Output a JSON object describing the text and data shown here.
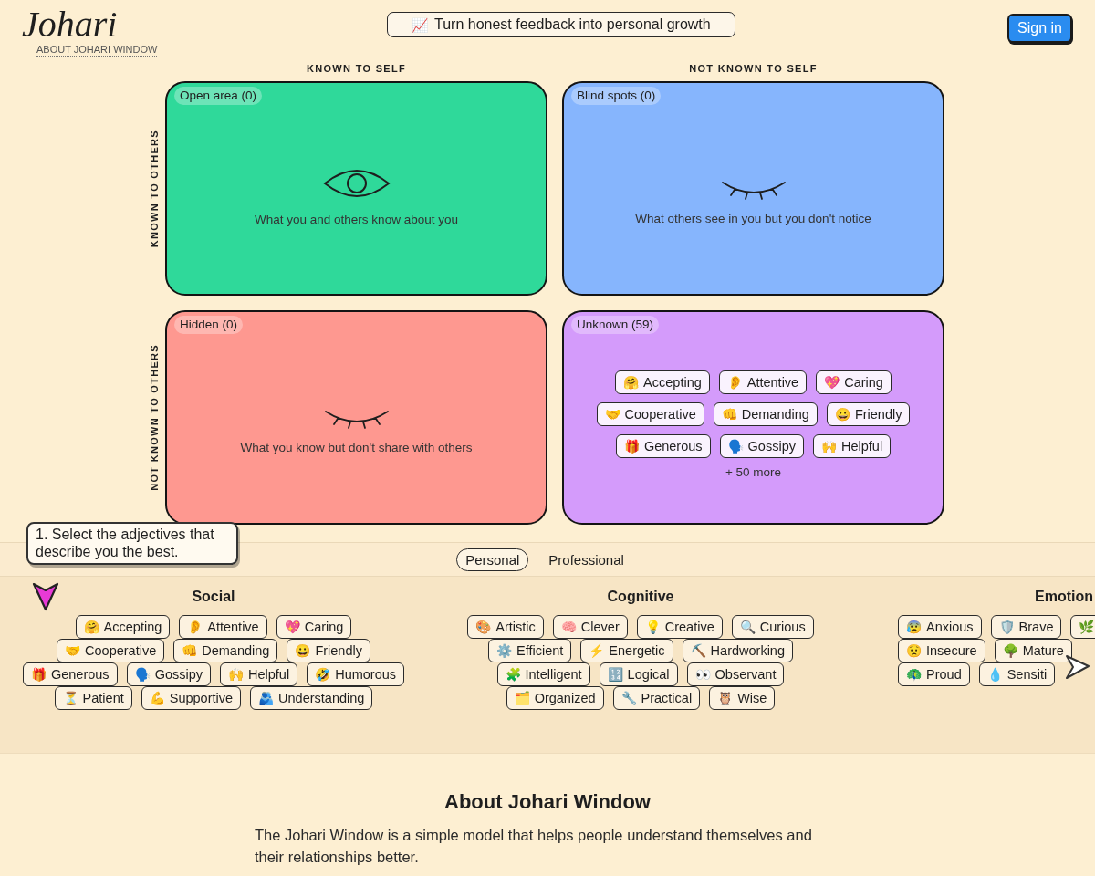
{
  "header": {
    "logo": "Johari",
    "about_link": "ABOUT JOHARI WINDOW",
    "tagline": {
      "emoji": "📈",
      "text": "Turn honest feedback into personal growth"
    },
    "sign_in": "Sign in"
  },
  "johari_window": {
    "column_headers": [
      "KNOWN TO SELF",
      "NOT KNOWN TO SELF"
    ],
    "row_headers": [
      "KNOWN TO OTHERS",
      "NOT KNOWN TO OTHERS"
    ],
    "quadrants": [
      {
        "kind": "open",
        "label": "Open area (0)",
        "color": "#2fd99a",
        "description": "What you and others know about you"
      },
      {
        "kind": "blind",
        "label": "Blind spots (0)",
        "color": "#86b5fd",
        "description": "What others see in you but you don't notice"
      },
      {
        "kind": "hidden",
        "label": "Hidden (0)",
        "color": "#fe9890",
        "description": "What you know but don't share with others"
      },
      {
        "kind": "unknown",
        "label": "Unknown (59)",
        "color": "#d49bfb",
        "chip_rows": [
          [
            {
              "emoji": "🤗",
              "label": "Accepting"
            },
            {
              "emoji": "👂",
              "label": "Attentive"
            },
            {
              "emoji": "💖",
              "label": "Caring"
            }
          ],
          [
            {
              "emoji": "🤝",
              "label": "Cooperative"
            },
            {
              "emoji": "👊",
              "label": "Demanding"
            },
            {
              "emoji": "😀",
              "label": "Friendly"
            }
          ],
          [
            {
              "emoji": "🎁",
              "label": "Generous"
            },
            {
              "emoji": "🗣️",
              "label": "Gossipy"
            },
            {
              "emoji": "🙌",
              "label": "Helpful"
            }
          ]
        ],
        "more": "+ 50 more"
      }
    ]
  },
  "tooltip": "1. Select the adjectives that describe you the best.",
  "tabs": [
    {
      "label": "Personal",
      "selected": true
    },
    {
      "label": "Professional",
      "selected": false
    }
  ],
  "categories": [
    {
      "title": "Social",
      "chip_rows": [
        [
          {
            "emoji": "🤗",
            "label": "Accepting"
          },
          {
            "emoji": "👂",
            "label": "Attentive"
          },
          {
            "emoji": "💖",
            "label": "Caring"
          }
        ],
        [
          {
            "emoji": "🤝",
            "label": "Cooperative"
          },
          {
            "emoji": "👊",
            "label": "Demanding"
          },
          {
            "emoji": "😀",
            "label": "Friendly"
          }
        ],
        [
          {
            "emoji": "🎁",
            "label": "Generous"
          },
          {
            "emoji": "🗣️",
            "label": "Gossipy"
          },
          {
            "emoji": "🙌",
            "label": "Helpful"
          },
          {
            "emoji": "🤣",
            "label": "Humorous"
          }
        ],
        [
          {
            "emoji": "⏳",
            "label": "Patient"
          },
          {
            "emoji": "💪",
            "label": "Supportive"
          },
          {
            "emoji": "🫂",
            "label": "Understanding"
          }
        ]
      ]
    },
    {
      "title": "Cognitive",
      "chip_rows": [
        [
          {
            "emoji": "🎨",
            "label": "Artistic"
          },
          {
            "emoji": "🧠",
            "label": "Clever"
          },
          {
            "emoji": "💡",
            "label": "Creative"
          },
          {
            "emoji": "🔍",
            "label": "Curious"
          }
        ],
        [
          {
            "emoji": "⚙️",
            "label": "Efficient"
          },
          {
            "emoji": "⚡",
            "label": "Energetic"
          },
          {
            "emoji": "⛏️",
            "label": "Hardworking"
          }
        ],
        [
          {
            "emoji": "🧩",
            "label": "Intelligent"
          },
          {
            "emoji": "🔢",
            "label": "Logical"
          },
          {
            "emoji": "👀",
            "label": "Observant"
          }
        ],
        [
          {
            "emoji": "🗂️",
            "label": "Organized"
          },
          {
            "emoji": "🔧",
            "label": "Practical"
          },
          {
            "emoji": "🦉",
            "label": "Wise"
          }
        ]
      ]
    },
    {
      "title": "Emotion",
      "chip_rows": [
        [
          {
            "emoji": "😰",
            "label": "Anxious"
          },
          {
            "emoji": "🛡️",
            "label": "Brave"
          },
          {
            "emoji": "🌿"
          }
        ],
        [
          {
            "emoji": "😟",
            "label": "Insecure"
          },
          {
            "emoji": "🌳",
            "label": "Mature"
          }
        ],
        [
          {
            "emoji": "🦚",
            "label": "Proud"
          },
          {
            "emoji": "💧",
            "label": "Sensiti"
          }
        ]
      ]
    }
  ],
  "about": {
    "title": "About Johari Window",
    "text": "The Johari Window is a simple model that helps people understand themselves and their relationships better."
  }
}
